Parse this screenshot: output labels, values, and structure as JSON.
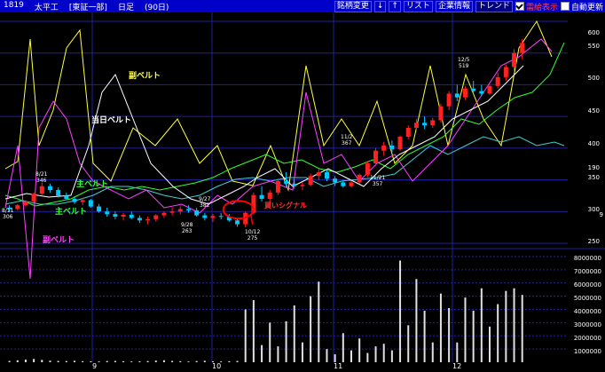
{
  "header": {
    "code": "1819",
    "name": "太平工",
    "market": "[東証一部]",
    "period": "日足",
    "days": "(90日)",
    "buttons": [
      "銘柄変更",
      "↓",
      "↑",
      "リスト",
      "企業情報",
      "トレンド"
    ],
    "checks": [
      {
        "label": "需給表示",
        "checked": true
      },
      {
        "label": "自動更新",
        "checked": false
      }
    ]
  },
  "labels": {
    "sub_belt_top": "副ベルト",
    "today_belt": "当日ベルト",
    "main_belt_1": "主ベルト",
    "main_belt_2": "主ベルト",
    "sub_belt_bottom": "副ベルト",
    "buy_signal": "買いシグナル"
  },
  "annotations": [
    {
      "date": "8/11",
      "price": "306"
    },
    {
      "date": "8/21",
      "price": "346"
    },
    {
      "date": "9/28",
      "price": "263"
    },
    {
      "date": "9/27",
      "price": "382"
    },
    {
      "date": "10/12",
      "price": "275"
    },
    {
      "date": "11/2",
      "price": "367"
    },
    {
      "date": "11/21",
      "price": "357"
    },
    {
      "date": "12/5",
      "price": "519"
    }
  ],
  "price_axis": [
    "600",
    "550",
    "500",
    "450",
    "400",
    "350",
    "300",
    "250"
  ],
  "price_axis_right_extra": [
    "400",
    "190",
    "9"
  ],
  "volume_axis": [
    "8000000",
    "7000000",
    "6000000",
    "5000000",
    "4000000",
    "3000000",
    "2000000",
    "1000000"
  ],
  "months": [
    "9",
    "10",
    "11",
    "12"
  ],
  "colors": {
    "header_bg": "#0000c8",
    "grid": "#2020a0",
    "up_candle": "#ff2020",
    "down_candle": "#00c8ff",
    "main_belt": "#30ff30",
    "sub_belt": "#ff40ff",
    "today_belt": "#ffffff",
    "yellow_line": "#ffff40",
    "cyan_line": "#40d0d0",
    "signal": "#ff0000"
  },
  "chart_data": {
    "type": "candlestick",
    "price_range": [
      250,
      600
    ],
    "volume_range": [
      0,
      8000000
    ],
    "candles": [
      [
        306,
        310,
        300,
        304
      ],
      [
        304,
        312,
        302,
        310
      ],
      [
        310,
        318,
        308,
        316
      ],
      [
        316,
        330,
        314,
        328
      ],
      [
        328,
        346,
        326,
        340
      ],
      [
        340,
        344,
        330,
        334
      ],
      [
        334,
        338,
        322,
        325
      ],
      [
        325,
        330,
        318,
        320
      ],
      [
        320,
        324,
        312,
        315
      ],
      [
        315,
        322,
        310,
        318
      ],
      [
        318,
        320,
        306,
        308
      ],
      [
        308,
        312,
        298,
        300
      ],
      [
        300,
        306,
        292,
        296
      ],
      [
        296,
        300,
        288,
        292
      ],
      [
        292,
        298,
        286,
        295
      ],
      [
        295,
        300,
        288,
        290
      ],
      [
        290,
        294,
        282,
        286
      ],
      [
        286,
        292,
        280,
        288
      ],
      [
        288,
        296,
        284,
        294
      ],
      [
        294,
        300,
        290,
        298
      ],
      [
        298,
        306,
        294,
        300
      ],
      [
        300,
        308,
        296,
        304
      ],
      [
        304,
        310,
        298,
        302
      ],
      [
        302,
        306,
        292,
        294
      ],
      [
        294,
        298,
        286,
        290
      ],
      [
        290,
        296,
        284,
        293
      ],
      [
        293,
        298,
        288,
        292
      ],
      [
        292,
        296,
        284,
        286
      ],
      [
        286,
        290,
        276,
        280
      ],
      [
        280,
        300,
        275,
        298
      ],
      [
        298,
        330,
        296,
        326
      ],
      [
        326,
        340,
        316,
        320
      ],
      [
        320,
        334,
        312,
        330
      ],
      [
        330,
        352,
        326,
        348
      ],
      [
        348,
        362,
        340,
        344
      ],
      [
        344,
        350,
        336,
        340
      ],
      [
        340,
        346,
        334,
        342
      ],
      [
        342,
        360,
        340,
        356
      ],
      [
        356,
        367,
        350,
        362
      ],
      [
        362,
        366,
        348,
        352
      ],
      [
        352,
        356,
        340,
        346
      ],
      [
        346,
        350,
        338,
        340
      ],
      [
        340,
        348,
        338,
        346
      ],
      [
        346,
        360,
        344,
        358
      ],
      [
        358,
        380,
        354,
        376
      ],
      [
        376,
        400,
        372,
        396
      ],
      [
        396,
        410,
        388,
        404
      ],
      [
        404,
        412,
        392,
        398
      ],
      [
        398,
        420,
        396,
        418
      ],
      [
        418,
        436,
        414,
        432
      ],
      [
        432,
        446,
        426,
        440
      ],
      [
        440,
        450,
        430,
        436
      ],
      [
        436,
        448,
        432,
        444
      ],
      [
        444,
        470,
        440,
        466
      ],
      [
        466,
        490,
        460,
        486
      ],
      [
        486,
        500,
        474,
        480
      ],
      [
        480,
        498,
        476,
        494
      ],
      [
        494,
        506,
        486,
        490
      ],
      [
        490,
        500,
        482,
        486
      ],
      [
        486,
        500,
        484,
        498
      ],
      [
        498,
        519,
        494,
        512
      ],
      [
        512,
        532,
        506,
        528
      ],
      [
        528,
        556,
        520,
        550
      ],
      [
        550,
        572,
        540,
        566
      ]
    ],
    "volumes": [
      100000,
      150000,
      200000,
      250000,
      180000,
      120000,
      100000,
      90000,
      110000,
      80000,
      70000,
      60000,
      90000,
      100000,
      80000,
      60000,
      70000,
      90000,
      120000,
      150000,
      100000,
      80000,
      60000,
      90000,
      110000,
      70000,
      60000,
      80000,
      100000,
      4000000,
      4700000,
      1300000,
      3000000,
      1200000,
      3100000,
      4300000,
      1500000,
      5000000,
      6100000,
      1000000,
      600000,
      2200000,
      900000,
      1800000,
      700000,
      1200000,
      1400000,
      900000,
      7700000,
      2800000,
      6300000,
      3900000,
      1500000,
      5200000,
      4100000,
      1500000,
      4900000,
      3900000,
      5600000,
      2700000,
      4400000,
      5400000,
      5600000,
      5100000
    ],
    "series": [
      {
        "name": "主ベルト"
      },
      {
        "name": "当日ベルト"
      },
      {
        "name": "副ベルト"
      }
    ]
  }
}
